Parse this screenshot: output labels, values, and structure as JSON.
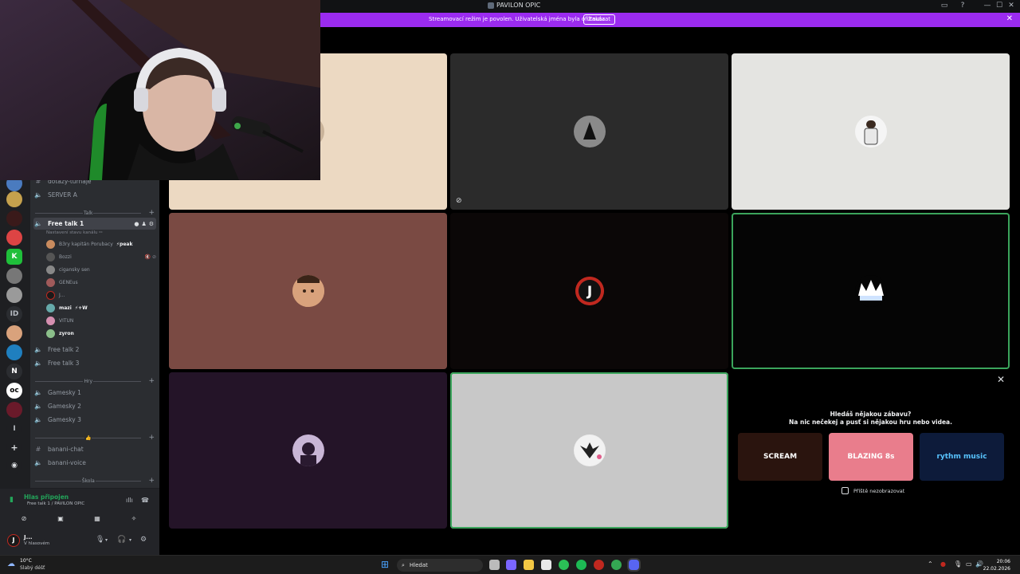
{
  "window": {
    "title": "PAVILON OPIC",
    "minimize_glyph": "—",
    "maximize_glyph": "☐",
    "close_glyph": "✕"
  },
  "banner": {
    "text": "Streamovací režim je povolen. Uživatelská jména byla ofiltnuta.",
    "disable_label": "Zakázat",
    "close_glyph": "✕"
  },
  "sidebar": {
    "channels_top": [
      {
        "label": "dotazy-turnaje",
        "icon": "hash-icon"
      },
      {
        "label": "SERVER A",
        "icon": "speaker-icon"
      }
    ],
    "categories": {
      "talk": "Talk",
      "hry": "Hry",
      "banani": "👍",
      "skola": "Škola"
    },
    "active_channel": {
      "label": "Free talk 1",
      "status_note": "Nastavení stavu kanálu ✏"
    },
    "voice_users": [
      {
        "name": "B3ry kapitán Porubacy",
        "tag": "⚡peak",
        "color": "#c98b5e"
      },
      {
        "name": "Bozzi",
        "tail": "🔇 ⊘",
        "color": "#555"
      },
      {
        "name": "cigansky sen",
        "color": "#888"
      },
      {
        "name": "GENEus",
        "color": "#a05a5a"
      },
      {
        "name": "J...",
        "color": "#1a1a1a"
      },
      {
        "name": "mazi",
        "tag": "⚡+W",
        "color": "#6aa",
        "bright": true
      },
      {
        "name": "VITUN",
        "color": "#d58fb0"
      },
      {
        "name": "zyron",
        "color": "#8bbf8a",
        "bright": true
      }
    ],
    "talk_channels": [
      "Free talk 2",
      "Free talk 3"
    ],
    "hry_channels": [
      "Gamesky 1",
      "Gamesky 2",
      "Gamesky 3"
    ],
    "banani_channels": [
      {
        "label": "banani-chat",
        "icon": "hash-icon"
      },
      {
        "label": "banani-voice",
        "icon": "speaker-icon"
      }
    ]
  },
  "voice_panel": {
    "title": "Hlas připojen",
    "subtitle": "Free talk 1 / PAVILON OPIC"
  },
  "user_panel": {
    "avatar_letter": "J",
    "name": "J...",
    "status": "V hlasovém"
  },
  "activity": {
    "heading": "Hledáš nějakou zábavu?",
    "subheading": "Na nic nečekej a pusť si nějakou hru nebo videa.",
    "games": [
      {
        "name": "SCREAM",
        "bg": "#2a140e",
        "fg": "#ffffff"
      },
      {
        "name": "BLAZING 8s",
        "bg": "#e97d8c",
        "fg": "#ffffff"
      },
      {
        "name": "rythm music",
        "bg": "#0d1b3a",
        "fg": "#58c4ff"
      }
    ],
    "dont_show_label": "Příště nezobrazovat"
  },
  "tiles": [
    {
      "id": "tile-1",
      "bg": "#ecd9c2",
      "avatar_bg": "#c9b39a"
    },
    {
      "id": "tile-2",
      "bg": "#2b2b2b",
      "avatar_bg": "#6b6b6b"
    },
    {
      "id": "tile-3",
      "bg": "#e4e4e1",
      "avatar_bg": "#f5f5f5"
    },
    {
      "id": "tile-4",
      "bg": "#7a4a43",
      "avatar_bg": "#d9a27c"
    },
    {
      "id": "tile-5",
      "bg": "#0b0707",
      "avatar_bg": "#c0281f"
    },
    {
      "id": "tile-6",
      "bg": "#050505",
      "avatar_bg": "#050505"
    },
    {
      "id": "tile-7",
      "bg": "#241428",
      "avatar_bg": "#5b3b68"
    },
    {
      "id": "tile-8",
      "bg": "#c8c8c8",
      "avatar_bg": "#efefef"
    }
  ],
  "taskbar": {
    "weather_temp": "10°C",
    "weather_desc": "Slabý déšť",
    "search_placeholder": "Hledat",
    "time": "20:06",
    "date": "22.02.2026"
  },
  "colors": {
    "accent": "#9b2bf0",
    "speaking": "#3ba55c",
    "voice_connected": "#23a55a"
  }
}
